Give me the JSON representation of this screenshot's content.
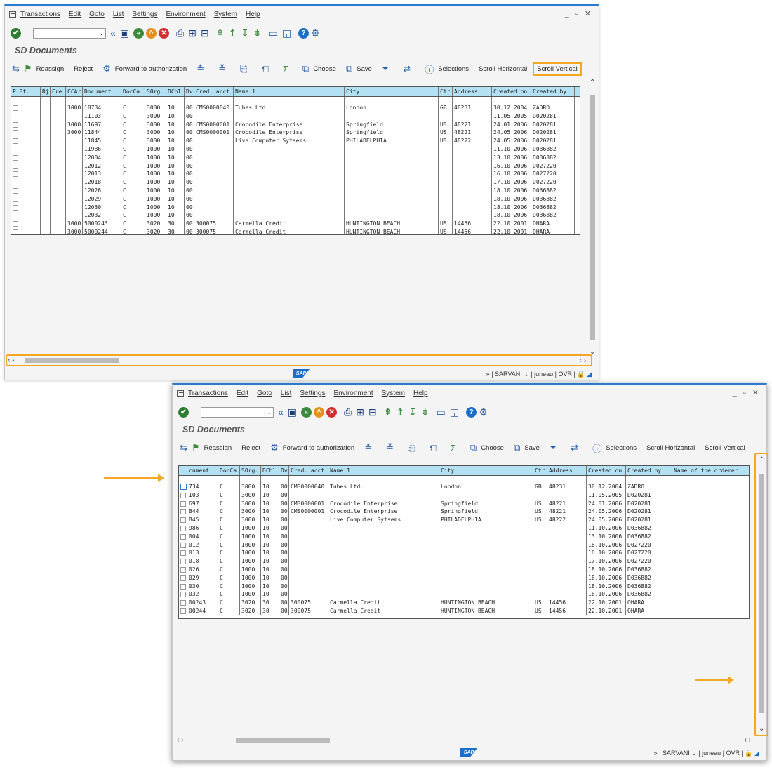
{
  "menu": [
    "Transactions",
    "Edit",
    "Goto",
    "List",
    "Settings",
    "Environment",
    "System",
    "Help"
  ],
  "window_controls": "_ ▫ ✕",
  "page_title": "SD Documents",
  "toolbar": {
    "reassign": "Reassign",
    "reject": "Reject",
    "forward": "Forward to authorization",
    "choose": "Choose",
    "save": "Save",
    "selections": "Selections",
    "scroll_horizontal": "Scroll Horizontal",
    "scroll_vertical": "Scroll Vertical"
  },
  "status": {
    "more": "»",
    "system": "SARVANI",
    "client": "juneau",
    "mode": "OVR"
  },
  "colors": {
    "accent_blue": "#2a7bd0",
    "header_bg": "#b3e0f2",
    "highlight": "#f5a623",
    "sap_blue": "#1b6fc9"
  },
  "grid1": {
    "headers": [
      "P.St.",
      "Rj",
      "Cre",
      "CCAr",
      "Document",
      "DocCa",
      "SOrg.",
      "DChl",
      "Dv",
      "Cred. acct",
      "Name 1",
      "City",
      "Ctr",
      "Address",
      "Created on",
      "Created by"
    ],
    "rows": [
      [
        "",
        "",
        "",
        "3000",
        "10734",
        "C",
        "3000",
        "10",
        "00",
        "CMS0000040",
        "Tubes Ltd.",
        "London",
        "GB",
        "48231",
        "30.12.2004",
        "ZADRO"
      ],
      [
        "",
        "",
        "",
        "",
        "11103",
        "C",
        "3000",
        "10",
        "00",
        "",
        "",
        "",
        "",
        "",
        "11.05.2005",
        "D020281"
      ],
      [
        "",
        "",
        "",
        "3000",
        "11697",
        "C",
        "3000",
        "10",
        "00",
        "CMS0000001",
        "Crocodile Enterprise",
        "Springfield",
        "US",
        "48221",
        "24.01.2006",
        "D020281"
      ],
      [
        "",
        "",
        "",
        "3000",
        "11844",
        "C",
        "3000",
        "10",
        "00",
        "CMS0000001",
        "Crocodile Enterprise",
        "Springfield",
        "US",
        "48221",
        "24.05.2006",
        "D020281"
      ],
      [
        "",
        "",
        "",
        "",
        "11845",
        "C",
        "3000",
        "10",
        "00",
        "",
        "Live Computer Sytsems",
        "PHILADELPHIA",
        "US",
        "48222",
        "24.05.2006",
        "D020281"
      ],
      [
        "",
        "",
        "",
        "",
        "11986",
        "C",
        "1000",
        "10",
        "00",
        "",
        "",
        "",
        "",
        "",
        "11.10.2006",
        "D036882"
      ],
      [
        "",
        "",
        "",
        "",
        "12004",
        "C",
        "1000",
        "10",
        "00",
        "",
        "",
        "",
        "",
        "",
        "13.10.2006",
        "D036882"
      ],
      [
        "",
        "",
        "",
        "",
        "12012",
        "C",
        "1000",
        "10",
        "00",
        "",
        "",
        "",
        "",
        "",
        "16.10.2006",
        "D027220"
      ],
      [
        "",
        "",
        "",
        "",
        "12013",
        "C",
        "1000",
        "10",
        "00",
        "",
        "",
        "",
        "",
        "",
        "16.10.2006",
        "D027220"
      ],
      [
        "",
        "",
        "",
        "",
        "12018",
        "C",
        "1000",
        "10",
        "00",
        "",
        "",
        "",
        "",
        "",
        "17.10.2006",
        "D027220"
      ],
      [
        "",
        "",
        "",
        "",
        "12026",
        "C",
        "1000",
        "10",
        "00",
        "",
        "",
        "",
        "",
        "",
        "18.10.2006",
        "D036882"
      ],
      [
        "",
        "",
        "",
        "",
        "12029",
        "C",
        "1000",
        "10",
        "00",
        "",
        "",
        "",
        "",
        "",
        "18.10.2006",
        "D036882"
      ],
      [
        "",
        "",
        "",
        "",
        "12030",
        "C",
        "1000",
        "10",
        "00",
        "",
        "",
        "",
        "",
        "",
        "18.10.2006",
        "D036882"
      ],
      [
        "",
        "",
        "",
        "",
        "12032",
        "C",
        "1000",
        "10",
        "00",
        "",
        "",
        "",
        "",
        "",
        "18.10.2006",
        "D036882"
      ],
      [
        "",
        "",
        "",
        "3000",
        "5000243",
        "C",
        "3020",
        "30",
        "00",
        "300075",
        "Carmella Credit",
        "HUNTINGTON BEACH",
        "US",
        "14456",
        "22.10.2001",
        "OHARA"
      ],
      [
        "",
        "",
        "",
        "3000",
        "5000244",
        "C",
        "3020",
        "30",
        "00",
        "300075",
        "Carmella Credit",
        "HUNTINGTON BEACH",
        "US",
        "14456",
        "22.10.2001",
        "OHARA"
      ]
    ]
  },
  "grid2": {
    "headers": [
      "cument",
      "DocCa",
      "SOrg.",
      "DChl",
      "Dv",
      "Cred. acct",
      "Name 1",
      "City",
      "Ctr",
      "Address",
      "Created on",
      "Created by",
      "Name of the orderer"
    ],
    "rows": [
      [
        "734",
        "C",
        "3000",
        "10",
        "00",
        "CMS0000040",
        "Tubes Ltd.",
        "London",
        "GB",
        "48231",
        "30.12.2004",
        "ZADRO",
        ""
      ],
      [
        "103",
        "C",
        "3000",
        "10",
        "00",
        "",
        "",
        "",
        "",
        "",
        "11.05.2005",
        "D020281",
        ""
      ],
      [
        "697",
        "C",
        "3000",
        "10",
        "00",
        "CMS0000001",
        "Crocodile Enterprise",
        "Springfield",
        "US",
        "48221",
        "24.01.2006",
        "D020281",
        ""
      ],
      [
        "844",
        "C",
        "3000",
        "10",
        "00",
        "CMS0000001",
        "Crocodile Enterprise",
        "Springfield",
        "US",
        "48221",
        "24.05.2006",
        "D020281",
        ""
      ],
      [
        "845",
        "C",
        "3000",
        "10",
        "00",
        "",
        "Live Computer Sytsems",
        "PHILADELPHIA",
        "US",
        "48222",
        "24.05.2006",
        "D020281",
        ""
      ],
      [
        "986",
        "C",
        "1000",
        "10",
        "00",
        "",
        "",
        "",
        "",
        "",
        "11.10.2006",
        "D036882",
        ""
      ],
      [
        "004",
        "C",
        "1000",
        "10",
        "00",
        "",
        "",
        "",
        "",
        "",
        "13.10.2006",
        "D036882",
        ""
      ],
      [
        "012",
        "C",
        "1000",
        "10",
        "00",
        "",
        "",
        "",
        "",
        "",
        "16.10.2006",
        "D027220",
        ""
      ],
      [
        "013",
        "C",
        "1000",
        "10",
        "00",
        "",
        "",
        "",
        "",
        "",
        "16.10.2006",
        "D027220",
        ""
      ],
      [
        "018",
        "C",
        "1000",
        "10",
        "00",
        "",
        "",
        "",
        "",
        "",
        "17.10.2006",
        "D027220",
        ""
      ],
      [
        "026",
        "C",
        "1000",
        "10",
        "00",
        "",
        "",
        "",
        "",
        "",
        "18.10.2006",
        "D036882",
        ""
      ],
      [
        "029",
        "C",
        "1000",
        "10",
        "00",
        "",
        "",
        "",
        "",
        "",
        "18.10.2006",
        "D036882",
        ""
      ],
      [
        "030",
        "C",
        "1000",
        "10",
        "00",
        "",
        "",
        "",
        "",
        "",
        "18.10.2006",
        "D036882",
        ""
      ],
      [
        "032",
        "C",
        "1000",
        "10",
        "00",
        "",
        "",
        "",
        "",
        "",
        "18.10.2006",
        "D036882",
        ""
      ],
      [
        "00243",
        "C",
        "3020",
        "30",
        "00",
        "300075",
        "Carmella Credit",
        "HUNTINGTON BEACH",
        "US",
        "14456",
        "22.10.2001",
        "OHARA",
        ""
      ],
      [
        "00244",
        "C",
        "3020",
        "30",
        "00",
        "300075",
        "Carmella Credit",
        "HUNTINGTON BEACH",
        "US",
        "14456",
        "22.10.2001",
        "OHARA",
        ""
      ]
    ]
  }
}
